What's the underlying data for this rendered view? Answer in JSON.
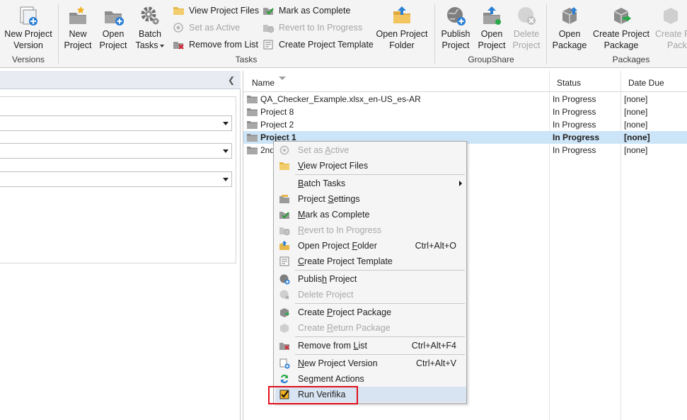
{
  "ribbon": {
    "versions": {
      "new_version_l1": "New Project",
      "new_version_l2": "Version",
      "group_label": "Versions"
    },
    "tasks": {
      "new_project_l1": "New",
      "new_project_l2": "Project",
      "open_project_l1": "Open",
      "open_project_l2": "Project",
      "batch_tasks_l1": "Batch",
      "batch_tasks_l2": "Tasks",
      "view_project_files": "View Project Files",
      "set_as_active": "Set as Active",
      "remove_from_list": "Remove from List",
      "mark_as_complete": "Mark as Complete",
      "revert_to_in_progress": "Revert to In Progress",
      "create_project_template": "Create Project Template",
      "open_project_folder_l1": "Open Project",
      "open_project_folder_l2": "Folder",
      "group_label": "Tasks"
    },
    "groupshare": {
      "publish_l1": "Publish",
      "publish_l2": "Project",
      "open_l1": "Open",
      "open_l2": "Project",
      "delete_l1": "Delete",
      "delete_l2": "Project",
      "group_label": "GroupShare"
    },
    "packages": {
      "open_package_l1": "Open",
      "open_package_l2": "Package",
      "create_package_l1": "Create Project",
      "create_package_l2": "Package",
      "create_return_l1": "Create R",
      "create_return_l2": "Pack",
      "group_label": "Packages"
    }
  },
  "grid": {
    "columns": {
      "name": "Name",
      "status": "Status",
      "date_due": "Date Due"
    },
    "rows": [
      {
        "name": "QA_Checker_Example.xlsx_en-US_es-AR",
        "status": "In Progress",
        "date_due": "[none]"
      },
      {
        "name": "Project 8",
        "status": "In Progress",
        "date_due": "[none]"
      },
      {
        "name": "Project 2",
        "status": "In Progress",
        "date_due": "[none]"
      },
      {
        "name": "Project 1",
        "status": "In Progress",
        "date_due": "[none]"
      },
      {
        "name": "2nd",
        "status": "In Progress",
        "date_due": "[none]"
      }
    ]
  },
  "context_menu": {
    "items": [
      {
        "label": "Set as Active",
        "underline": "A",
        "shortcut": "",
        "enabled": false
      },
      {
        "label": "View Project Files",
        "underline": "V",
        "shortcut": "",
        "enabled": true
      },
      {
        "label": "Batch Tasks",
        "underline": "B",
        "shortcut": "",
        "enabled": true
      },
      {
        "label": "Project Settings",
        "underline": "S",
        "shortcut": "",
        "enabled": true
      },
      {
        "label": "Mark as Complete",
        "underline": "M",
        "shortcut": "",
        "enabled": true
      },
      {
        "label": "Revert to In Progress",
        "underline": "R",
        "shortcut": "",
        "enabled": false
      },
      {
        "label": "Open Project Folder",
        "underline": "F",
        "shortcut": "Ctrl+Alt+O",
        "enabled": true
      },
      {
        "label": "Create Project Template",
        "underline": "C",
        "shortcut": "",
        "enabled": true
      },
      {
        "label": "Publish Project",
        "underline": "h",
        "shortcut": "",
        "enabled": true
      },
      {
        "label": "Delete Project",
        "underline": "",
        "shortcut": "",
        "enabled": false
      },
      {
        "label": "Create Project Package",
        "underline": "P",
        "shortcut": "",
        "enabled": true
      },
      {
        "label": "Create Return Package",
        "underline": "R",
        "shortcut": "",
        "enabled": false
      },
      {
        "label": "Remove from List",
        "underline": "L",
        "shortcut": "Ctrl+Alt+F4",
        "enabled": true
      },
      {
        "label": "New Project Version",
        "underline": "N",
        "shortcut": "Ctrl+Alt+V",
        "enabled": true
      },
      {
        "label": "Segment Actions",
        "underline": "",
        "shortcut": "",
        "enabled": true
      },
      {
        "label": "Run Verifika",
        "underline": "",
        "shortcut": "",
        "enabled": true
      }
    ]
  },
  "colors": {
    "selection": "#cce4f7",
    "menu_hover": "#d8e4f2",
    "highlight_box": "#e0101c",
    "disabled_text": "#a8a8a8"
  }
}
